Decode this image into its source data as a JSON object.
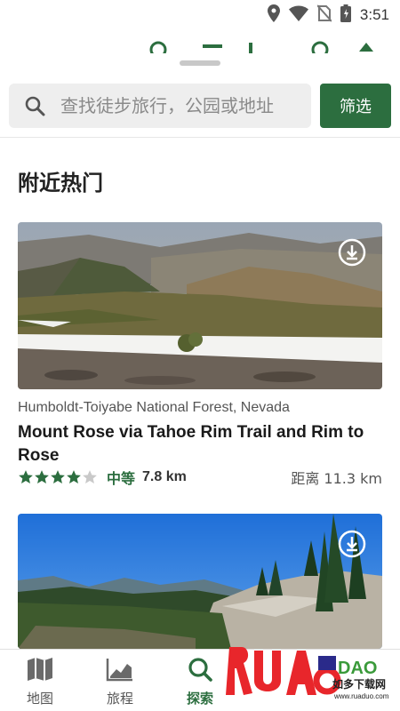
{
  "status_bar": {
    "time": "3:51",
    "icons": [
      "location-icon",
      "wifi-icon",
      "no-sim-icon",
      "battery-icon"
    ]
  },
  "search": {
    "placeholder": "查找徒步旅行，公园或地址",
    "filter_label": "筛选"
  },
  "section": {
    "title": "附近热门"
  },
  "trails": [
    {
      "location": "Humboldt-Toiyabe National Forest, Nevada",
      "name": "Mount Rose via Tahoe Rim Trail and Rim to Rose",
      "rating": 4,
      "rating_max": 5,
      "difficulty": "中等",
      "length": "7.8 km",
      "distance": "距离 11.3 km"
    },
    {}
  ],
  "bottom_nav": {
    "items": [
      {
        "label": "地图",
        "icon": "map-icon",
        "active": false
      },
      {
        "label": "旅程",
        "icon": "activity-chart-icon",
        "active": false
      },
      {
        "label": "探索",
        "icon": "search-icon",
        "active": true
      }
    ]
  },
  "watermark": {
    "brand": "RUANDAO",
    "text": "如多下载网",
    "url": "www.ruaduo.com"
  },
  "colors": {
    "accent": "#2c6e3f",
    "star_filled": "#2c6e3f",
    "star_empty": "#c9c9c9"
  }
}
